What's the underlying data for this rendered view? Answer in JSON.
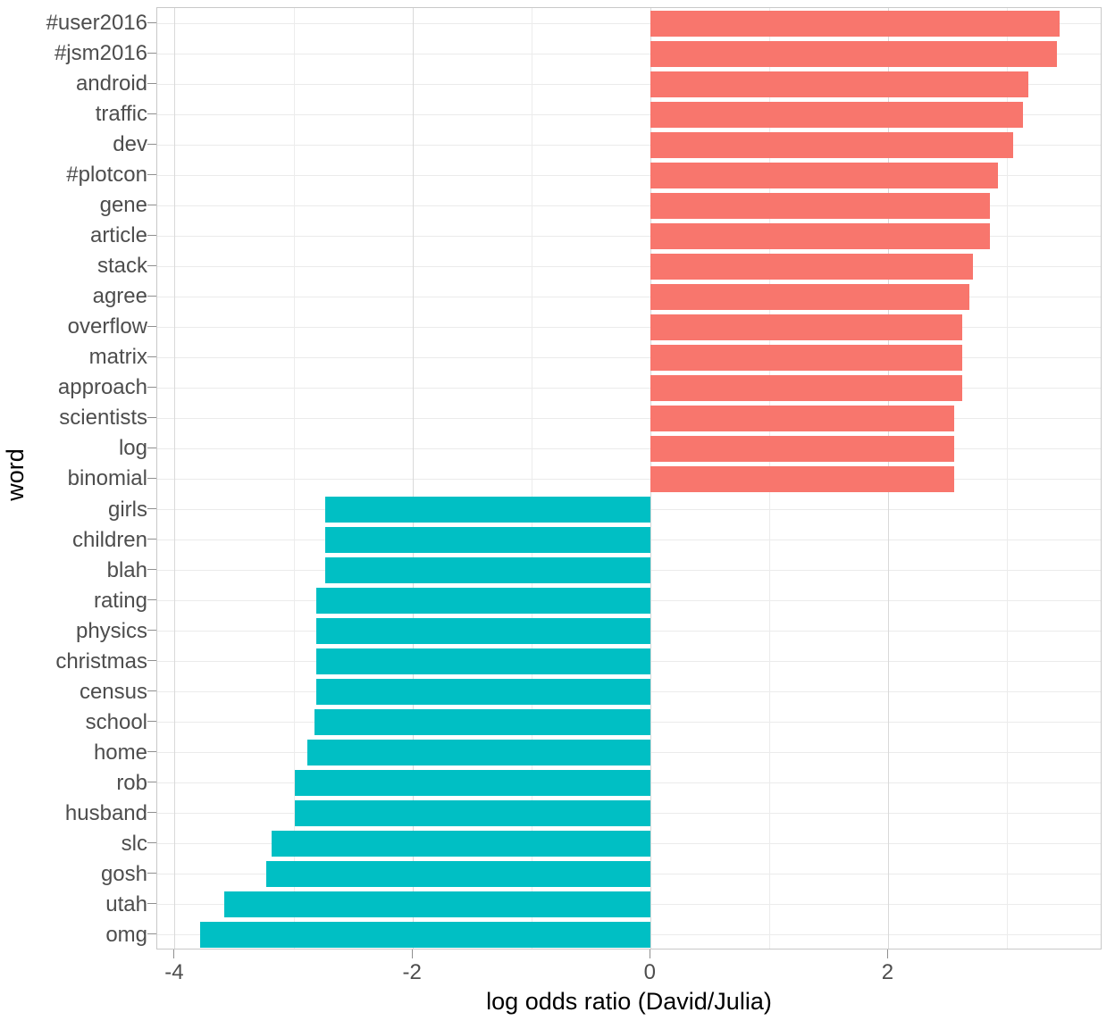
{
  "chart_data": {
    "type": "bar",
    "orientation": "horizontal",
    "title": "",
    "xlabel": "log odds ratio (David/Julia)",
    "ylabel": "word",
    "xlim": [
      -4.15,
      3.8
    ],
    "xticks": [
      -4,
      -2,
      0,
      2
    ],
    "xtick_labels": [
      "-4",
      "-2",
      "0",
      "2"
    ],
    "xminor_ticks": [
      -3,
      -1,
      1,
      3
    ],
    "grid": true,
    "legend": "none",
    "colors": {
      "positive": "#F8766D",
      "negative": "#00BFC4",
      "panel_background": "#FFFFFF",
      "panel_border": "#C8C8C8",
      "major_grid": "#EBEBEB",
      "minor_grid": "#ECECEC",
      "axis_text": "#4D4D4D",
      "axis_title": "#000000"
    },
    "categories": [
      "#user2016",
      "#jsm2016",
      "android",
      "traffic",
      "dev",
      "#plotcon",
      "gene",
      "article",
      "stack",
      "agree",
      "overflow",
      "matrix",
      "approach",
      "scientists",
      "log",
      "binomial",
      "girls",
      "children",
      "blah",
      "rating",
      "physics",
      "christmas",
      "census",
      "school",
      "home",
      "rob",
      "husband",
      "slc",
      "gosh",
      "utah",
      "omg"
    ],
    "values": [
      3.44,
      3.42,
      3.18,
      3.13,
      3.05,
      2.92,
      2.85,
      2.85,
      2.71,
      2.68,
      2.62,
      2.62,
      2.62,
      2.55,
      2.55,
      2.55,
      -2.74,
      -2.74,
      -2.74,
      -2.81,
      -2.81,
      -2.81,
      -2.81,
      -2.83,
      -2.89,
      -2.99,
      -2.99,
      -3.19,
      -3.23,
      -3.59,
      -3.79
    ]
  }
}
